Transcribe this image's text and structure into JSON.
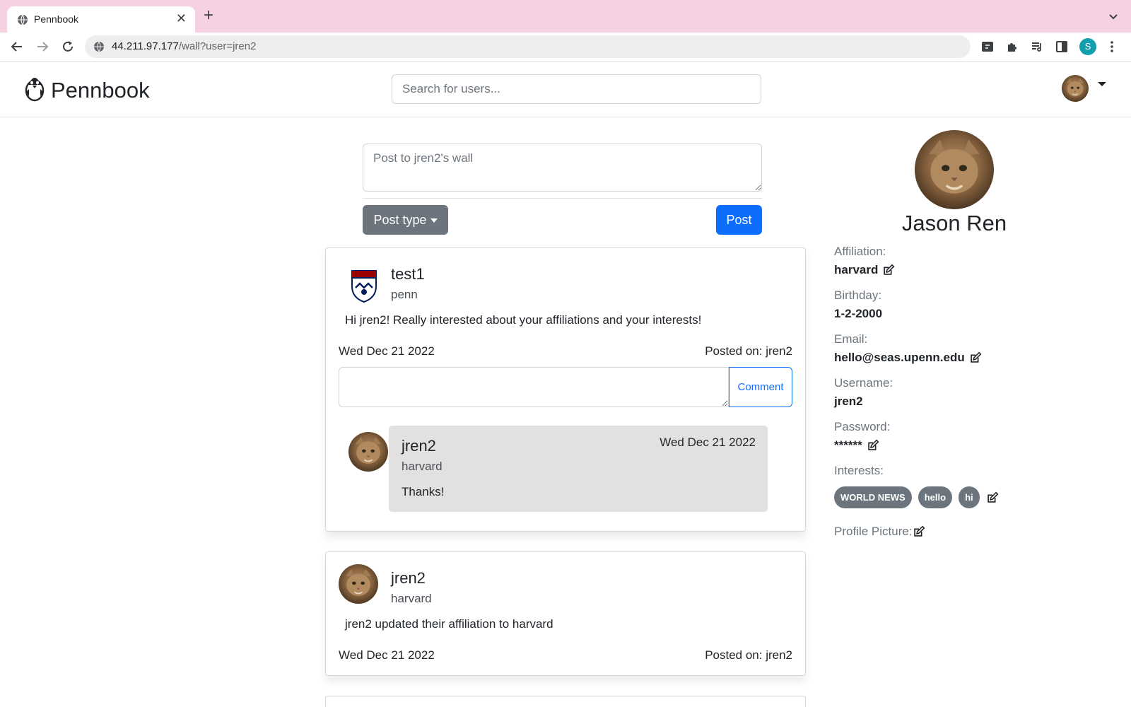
{
  "browser": {
    "tab_title": "Pennbook",
    "url_host": "44.211.97.177",
    "url_path": "/wall?user=jren2",
    "profile_initial": "S"
  },
  "app": {
    "brand": "Pennbook",
    "search_placeholder": "Search for users..."
  },
  "composer": {
    "placeholder": "Post to jren2's wall",
    "post_type_label": "Post type",
    "post_label": "Post"
  },
  "posts": [
    {
      "author": "test1",
      "affiliation": "penn",
      "avatar": "penn-shield-icon",
      "body": "Hi jren2! Really interested about your affiliations and your interests!",
      "date": "Wed Dec 21 2022",
      "posted_on": "Posted on: jren2",
      "comment_button": "Comment",
      "comments": [
        {
          "author": "jren2",
          "affiliation": "harvard",
          "date": "Wed Dec 21 2022",
          "text": "Thanks!"
        }
      ]
    },
    {
      "author": "jren2",
      "affiliation": "harvard",
      "avatar": "cat-avatar",
      "body": "jren2 updated their affiliation to harvard",
      "date": "Wed Dec 21 2022",
      "posted_on": "Posted on: jren2"
    }
  ],
  "profile": {
    "name": "Jason Ren",
    "affiliation_label": "Affiliation:",
    "affiliation": "harvard",
    "birthday_label": "Birthday:",
    "birthday": "1-2-2000",
    "email_label": "Email:",
    "email": "hello@seas.upenn.edu",
    "username_label": "Username:",
    "username": "jren2",
    "password_label": "Password:",
    "password": "******",
    "interests_label": "Interests:",
    "interests": [
      "WORLD NEWS",
      "hello",
      "hi"
    ],
    "profile_picture_label": "Profile Picture:"
  },
  "colors": {
    "primary": "#0d6efd",
    "secondary": "#6c757d",
    "tabbar": "#f6d1e2",
    "comment_bg": "#e3e0e0"
  }
}
